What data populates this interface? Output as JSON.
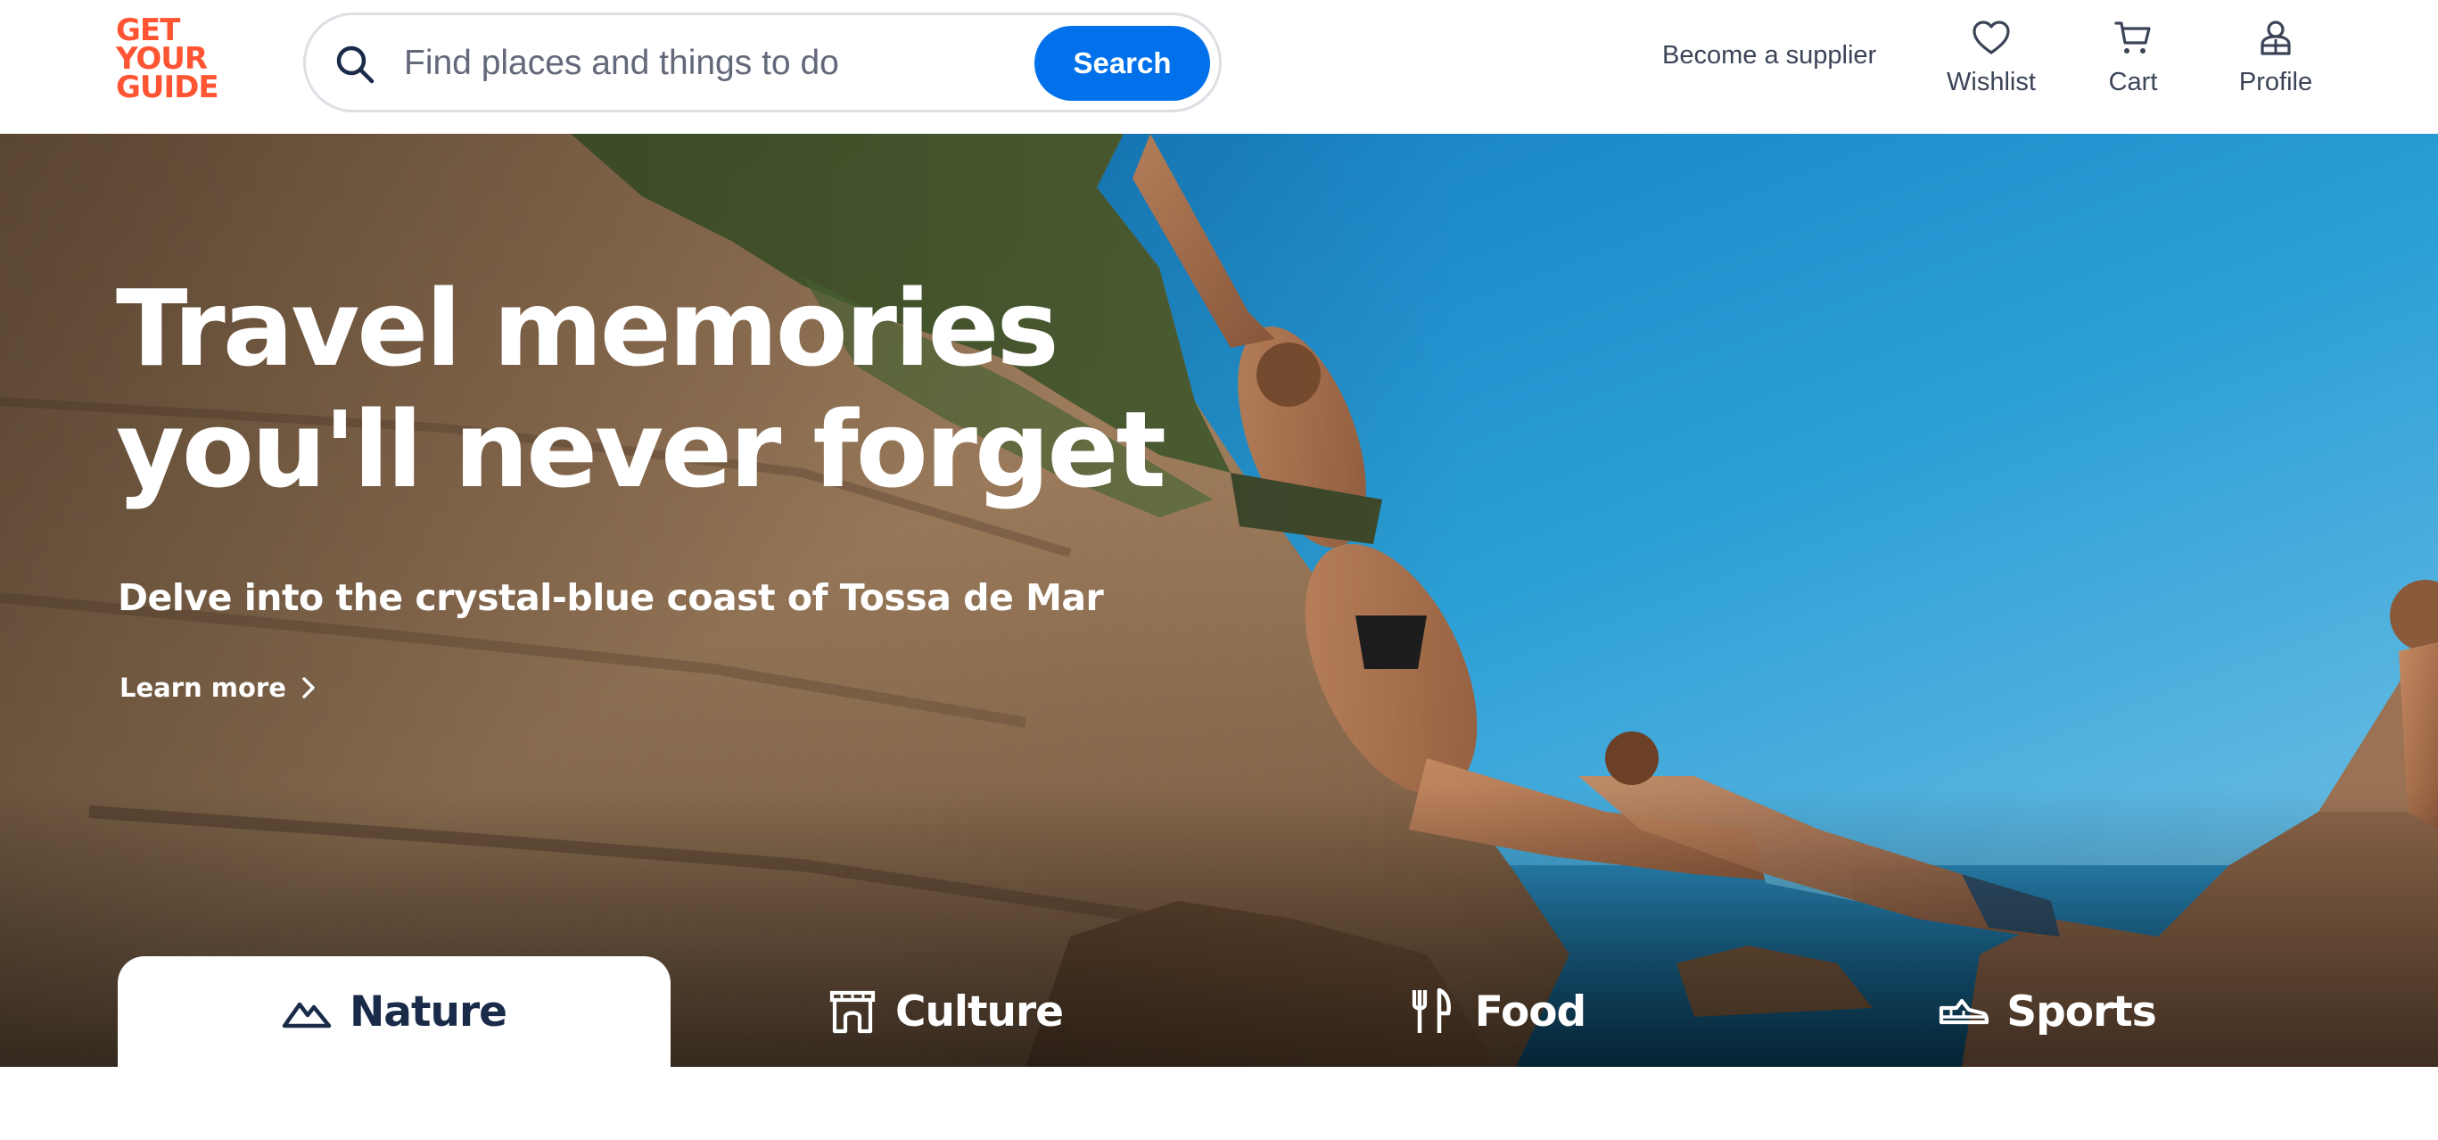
{
  "brand": {
    "logo_lines": [
      "GET",
      "YOUR",
      "GUIDE"
    ],
    "color": "#ff5533"
  },
  "search": {
    "placeholder": "Find places and things to do",
    "button_label": "Search",
    "icon": "search-icon",
    "button_color": "#0071eb"
  },
  "header": {
    "supplier_link": "Become a supplier",
    "nav": [
      {
        "label": "Wishlist",
        "icon": "heart-icon"
      },
      {
        "label": "Cart",
        "icon": "cart-icon"
      },
      {
        "label": "Profile",
        "icon": "profile-icon"
      }
    ]
  },
  "hero": {
    "title_lines": [
      "Travel memories",
      "you'll never forget"
    ],
    "subtitle": "Delve into the crystal-blue coast of Tossa de Mar",
    "link_label": "Learn more",
    "link_icon": "chevron-right-icon"
  },
  "categories": {
    "active": "Nature",
    "tabs": [
      {
        "label": "Nature",
        "icon": "mountain-icon"
      },
      {
        "label": "Culture",
        "icon": "landmark-icon"
      },
      {
        "label": "Food",
        "icon": "fork-knife-icon"
      },
      {
        "label": "Sports",
        "icon": "sneaker-icon"
      }
    ]
  }
}
